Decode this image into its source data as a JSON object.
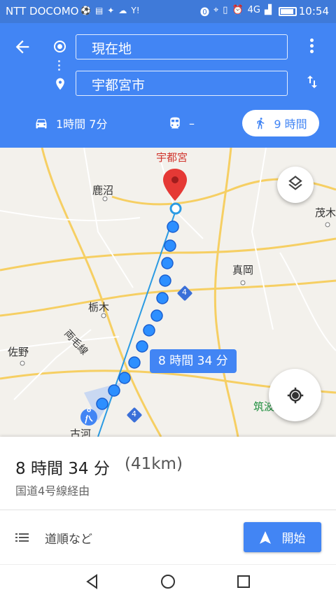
{
  "status_bar": {
    "carrier": "NTT DOCOMO",
    "time": "10:54",
    "network": "4G"
  },
  "header": {
    "origin": "現在地",
    "destination": "宇都宮市"
  },
  "travel_modes": {
    "car": "1時間 7分",
    "transit": "–",
    "walk": "9 時間"
  },
  "map": {
    "places": {
      "utsunomiya": "宇都宮",
      "kanuma": "鹿沼",
      "moka": "真岡",
      "tochigi": "栃木",
      "sano": "佐野",
      "koga": "古河",
      "tsukuba": "筑波山",
      "motegi": "茂木",
      "ryomo_line": "両毛線",
      "route4_a": "4",
      "route4_b": "4"
    },
    "route_duration": "8 時間 34 分",
    "colors": {
      "route": "#4285f4",
      "destination_pin": "#e53935"
    }
  },
  "summary": {
    "duration": "8 時間 34 分",
    "distance": "(41km)",
    "via": "国道4号線経由",
    "steps_label": "道順など",
    "start_label": "開始"
  },
  "colors": {
    "primary": "#4285f4",
    "status_bar": "#3f7ad9"
  }
}
